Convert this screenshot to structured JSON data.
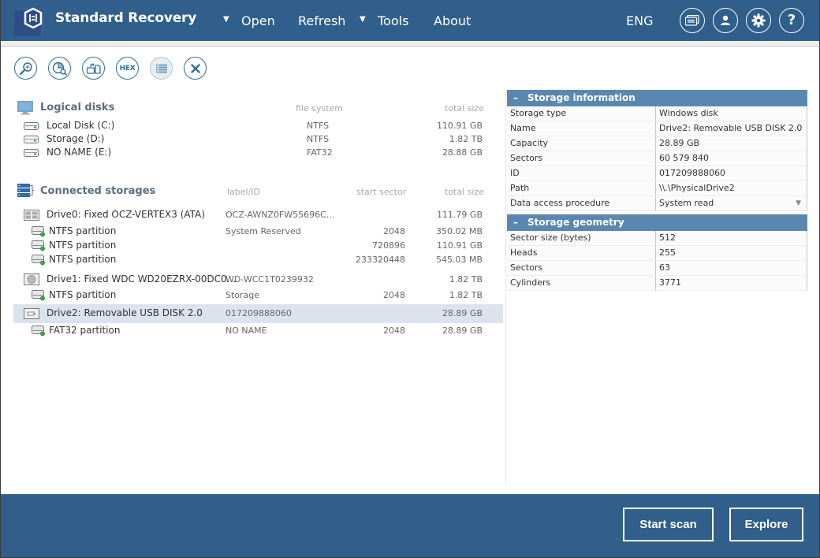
{
  "header": {
    "app_title": "Standard Recovery",
    "menu": [
      {
        "label": "Open",
        "has_dropdown": true
      },
      {
        "label": "Refresh",
        "has_dropdown": false
      },
      {
        "label": "Tools",
        "has_dropdown": true
      },
      {
        "label": "About",
        "has_dropdown": false
      }
    ],
    "language": "ENG",
    "icon_buttons": [
      "messages-icon",
      "account-icon",
      "settings-icon",
      "help-icon"
    ]
  },
  "toolbar": {
    "buttons": [
      {
        "name": "search-icon",
        "label": ""
      },
      {
        "name": "scan-region-icon",
        "label": ""
      },
      {
        "name": "create-image-icon",
        "label": ""
      },
      {
        "name": "hex-button",
        "label": "HEX"
      },
      {
        "name": "list-icon",
        "label": "",
        "disabled": true
      },
      {
        "name": "close-icon",
        "label": ""
      }
    ]
  },
  "logical_disks": {
    "title": "Logical disks",
    "columns": {
      "file_system": "file system",
      "total_size": "total size"
    },
    "items": [
      {
        "name": "Local Disk (C:)",
        "file_system": "NTFS",
        "total_size": "110.91 GB"
      },
      {
        "name": "Storage (D:)",
        "file_system": "NTFS",
        "total_size": "1.82 TB"
      },
      {
        "name": "NO NAME (E:)",
        "file_system": "FAT32",
        "total_size": "28.88 GB"
      }
    ]
  },
  "connected_storages": {
    "title": "Connected storages",
    "columns": {
      "label_id": "label/ID",
      "start_sector": "start sector",
      "total_size": "total size"
    },
    "items": [
      {
        "kind": "drive",
        "icon": "ssd-icon",
        "name": "Drive0: Fixed OCZ-VERTEX3 (ATA)",
        "label_id": "OCZ-AWNZ0FW55696C...",
        "start_sector": "",
        "total_size": "111.79 GB"
      },
      {
        "kind": "partition",
        "name": "NTFS partition",
        "label_id": "System Reserved",
        "start_sector": "2048",
        "total_size": "350.02 MB"
      },
      {
        "kind": "partition",
        "name": "NTFS partition",
        "label_id": "",
        "start_sector": "720896",
        "total_size": "110.91 GB"
      },
      {
        "kind": "partition",
        "name": "NTFS partition",
        "label_id": "",
        "start_sector": "233320448",
        "total_size": "545.03 MB"
      },
      {
        "kind": "drive",
        "icon": "hdd-icon",
        "name": "Drive1: Fixed WDC WD20EZRX-00DC0...",
        "label_id": "WD-WCC1T0239932",
        "start_sector": "",
        "total_size": "1.82 TB"
      },
      {
        "kind": "partition",
        "name": "NTFS partition",
        "label_id": "Storage",
        "start_sector": "2048",
        "total_size": "1.82 TB"
      },
      {
        "kind": "drive",
        "icon": "usb-drive-icon",
        "name": "Drive2: Removable USB DISK 2.0",
        "label_id": "017209888060",
        "start_sector": "",
        "total_size": "28.89 GB",
        "selected": true
      },
      {
        "kind": "partition",
        "name": "FAT32 partition",
        "label_id": "NO NAME",
        "start_sector": "2048",
        "total_size": "28.89 GB"
      }
    ]
  },
  "storage_information": {
    "title": "Storage information",
    "collapse_symbol": "–",
    "rows": [
      {
        "key": "Storage type",
        "value": "Windows disk"
      },
      {
        "key": "Name",
        "value": "Drive2: Removable USB DISK 2.0"
      },
      {
        "key": "Capacity",
        "value": "28.89 GB"
      },
      {
        "key": "Sectors",
        "value": "60 579 840"
      },
      {
        "key": "ID",
        "value": "017209888060"
      },
      {
        "key": "Path",
        "value": "\\\\.\\PhysicalDrive2"
      },
      {
        "key": "Data access procedure",
        "value": "System read",
        "dropdown": true
      }
    ]
  },
  "storage_geometry": {
    "title": "Storage geometry",
    "collapse_symbol": "–",
    "rows": [
      {
        "key": "Sector size (bytes)",
        "value": "512"
      },
      {
        "key": "Heads",
        "value": "255"
      },
      {
        "key": "Sectors",
        "value": "63"
      },
      {
        "key": "Cylinders",
        "value": "3771"
      }
    ]
  },
  "footer": {
    "start_scan": "Start scan",
    "explore": "Explore"
  },
  "colors": {
    "header_bg": "#2f5f8a",
    "panel_header_bg": "#5a87b0",
    "selected_row_bg": "#dce3ec",
    "toolbar_icon": "#2f6f9a"
  }
}
